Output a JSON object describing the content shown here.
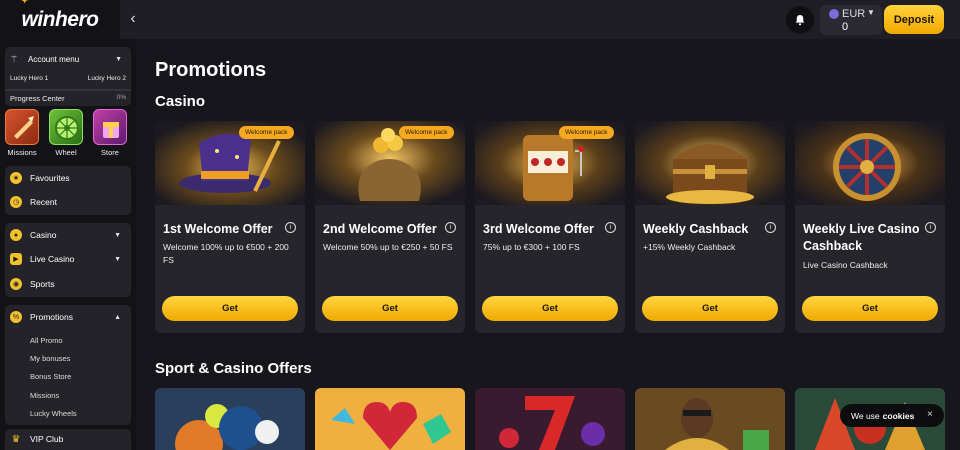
{
  "brand": {
    "logo": "winhero"
  },
  "header": {
    "back_icon": "chevron-left-icon",
    "currency": "EUR",
    "balance": "0",
    "deposit_label": "Deposit",
    "accent": "#f5b400"
  },
  "sidebar": {
    "account_menu": "Account menu",
    "level_current": "Lucky Hero 1",
    "level_next": "Lucky Hero 2",
    "progress_label": "Progress Center",
    "progress_pct": "0%",
    "tiles": [
      {
        "label": "Missions",
        "icon": "missions-icon"
      },
      {
        "label": "Wheel",
        "icon": "wheel-icon"
      },
      {
        "label": "Store",
        "icon": "store-icon"
      }
    ],
    "nav": {
      "favourites": "Favourites",
      "recent": "Recent",
      "casino": "Casino",
      "live_casino": "Live Casino",
      "sports": "Sports",
      "promotions": "Promotions",
      "vip": "VIP Club"
    },
    "promotions_sub": [
      "All Promo",
      "My bonuses",
      "Bonus Store",
      "Missions",
      "Lucky Wheels"
    ]
  },
  "main": {
    "title": "Promotions",
    "section_casino": "Casino",
    "section_sport": "Sport & Casino Offers",
    "cards": [
      {
        "badge": "Welcome pack",
        "title": "1st Welcome Offer",
        "desc": "Welcome 100% up to €500 + 200 FS",
        "button": "Get"
      },
      {
        "badge": "Welcome pack",
        "title": "2nd Welcome Offer",
        "desc": "Welcome 50% up to €250 + 50 FS",
        "button": "Get"
      },
      {
        "badge": "Welcome pack",
        "title": "3rd Welcome Offer",
        "desc": "75% up to €300 + 100 FS",
        "button": "Get"
      },
      {
        "badge": "",
        "title": "Weekly Cashback",
        "desc": "+15% Weekly Cashback",
        "button": "Get"
      },
      {
        "badge": "",
        "title": "Weekly Live Casino Cashback",
        "desc": "Live Casino Cashback",
        "button": "Get"
      }
    ]
  },
  "cookie": {
    "text": "We use",
    "link": "cookies",
    "close": "×"
  }
}
